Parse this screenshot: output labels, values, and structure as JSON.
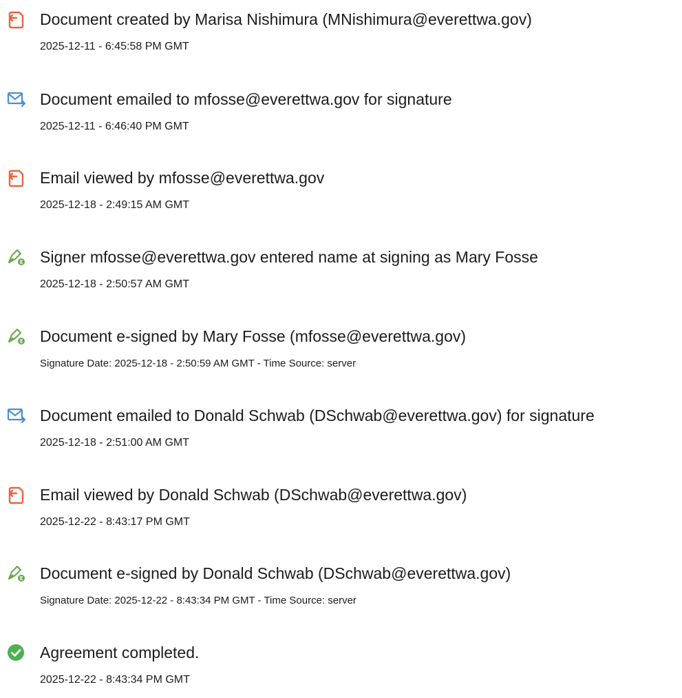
{
  "colors": {
    "document_icon": "#e8643c",
    "email_icon": "#4a8fd6",
    "esign_icon": "#6aa84f",
    "completed_icon": "#4caf50"
  },
  "events": [
    {
      "icon": "document-icon",
      "title": "Document created by Marisa Nishimura (MNishimura@everettwa.gov)",
      "detail": "2025-12-11 - 6:45:58 PM GMT"
    },
    {
      "icon": "email-sent-icon",
      "title": "Document emailed to mfosse@everettwa.gov for signature",
      "detail": "2025-12-11 - 6:46:40 PM GMT"
    },
    {
      "icon": "document-icon",
      "title": "Email viewed by mfosse@everettwa.gov",
      "detail": "2025-12-18 - 2:49:15 AM GMT"
    },
    {
      "icon": "esign-pen-icon",
      "title": "Signer mfosse@everettwa.gov entered name at signing as Mary Fosse",
      "detail": "2025-12-18 - 2:50:57 AM GMT"
    },
    {
      "icon": "esign-pen-icon",
      "title": "Document e-signed by Mary Fosse (mfosse@everettwa.gov)",
      "detail": "Signature Date: 2025-12-18 - 2:50:59 AM GMT - Time Source: server"
    },
    {
      "icon": "email-sent-icon",
      "title": "Document emailed to Donald Schwab (DSchwab@everettwa.gov) for signature",
      "detail": "2025-12-18 - 2:51:00 AM GMT"
    },
    {
      "icon": "document-icon",
      "title": "Email viewed by Donald Schwab (DSchwab@everettwa.gov)",
      "detail": "2025-12-22 - 8:43:17 PM GMT"
    },
    {
      "icon": "esign-pen-icon",
      "title": "Document e-signed by Donald Schwab (DSchwab@everettwa.gov)",
      "detail": "Signature Date: 2025-12-22 - 8:43:34 PM GMT - Time Source: server"
    },
    {
      "icon": "check-circle-icon",
      "title": "Agreement completed.",
      "detail": "2025-12-22 - 8:43:34 PM GMT"
    }
  ]
}
